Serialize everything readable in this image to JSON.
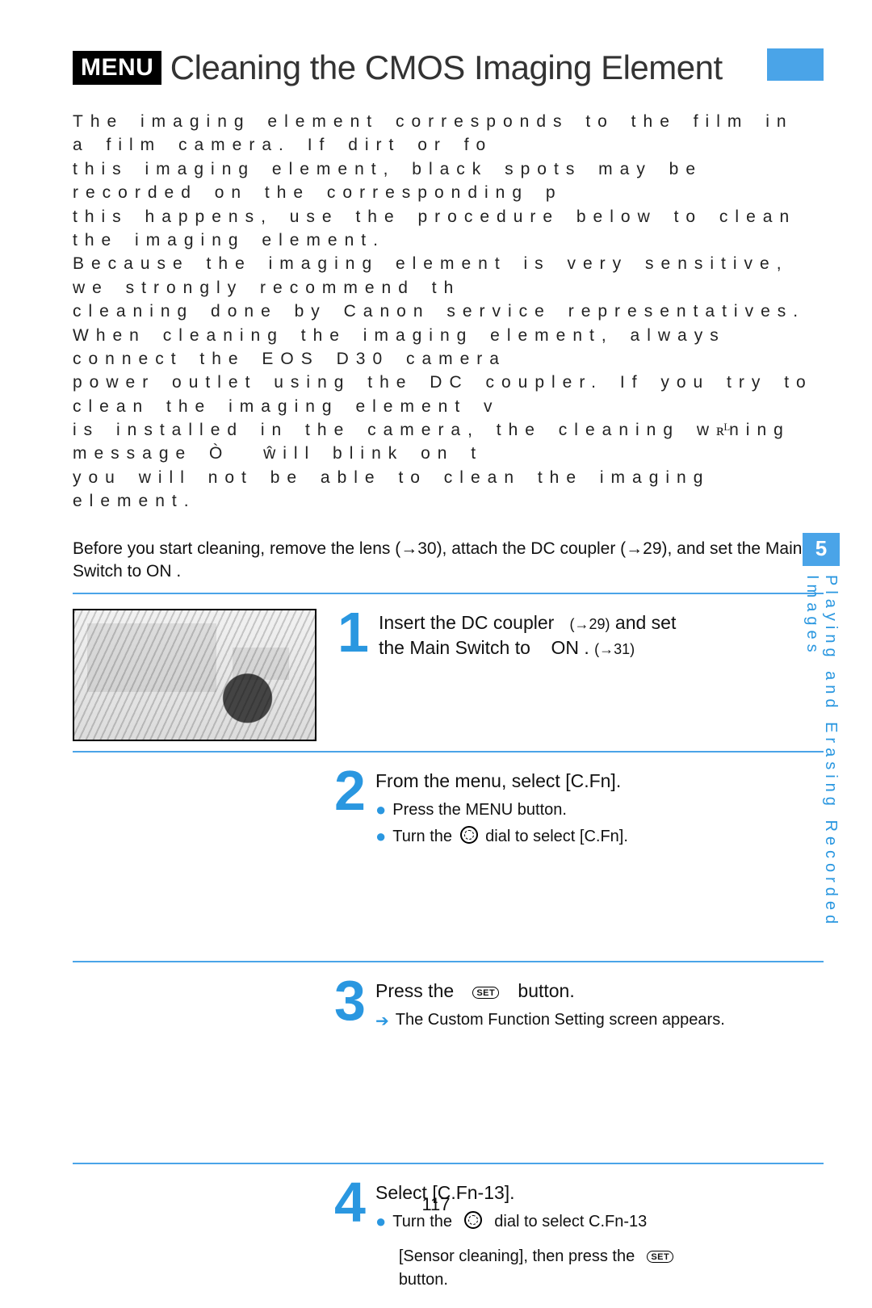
{
  "header": {
    "menu_badge": "MENU",
    "title": "Cleaning the CMOS Imaging Element"
  },
  "intro": {
    "p1": "The imaging element corresponds to the film in a film camera. If dirt or fo",
    "p2": "this imaging element, black spots may be recorded on the corresponding p",
    "p3": "this happens, use the procedure below to clean the imaging element.",
    "p4": "Because the imaging element is very sensitive, we strongly recommend th",
    "p5": "cleaning done by Canon service representatives.",
    "p6": "When cleaning the imaging element, always connect the EOS D30 camera",
    "p7_a": "power outlet using the DC coupler. If you try to clean the imaging element v",
    "p8_a": "is installed in the camera, the cleaning w",
    "p8_glyph": "ʀᴸ",
    "p8_b": "ning message Ò",
    "p8_c": "ŵill blink on t",
    "p9": "you will not be able to clean the imaging element."
  },
  "before": "Before you start cleaning, remove the lens (→30), attach the DC coupler (→29), and set the Main Switch to ON .",
  "steps": {
    "s1": {
      "num": "1",
      "line1_a": "Insert the DC coupler",
      "line1_ref": "(→29)",
      "line1_b": "and set",
      "line2_a": "the Main Switch to",
      "line2_b": "ON .",
      "line2_ref": "(→31)"
    },
    "s2": {
      "num": "2",
      "head": "From the menu, select [C.Fn].",
      "b1": "Press the  MENU  button.",
      "b2_a": "Turn the",
      "b2_b": "dial to select [C.Fn]."
    },
    "s3": {
      "num": "3",
      "head_a": "Press the",
      "set_label": "SET",
      "head_b": "button.",
      "arrow_text": "The Custom Function Setting screen appears."
    },
    "s4": {
      "num": "4",
      "head": "Select [C.Fn-13].",
      "b1_a": "Turn the",
      "b1_b": "dial to select C.Fn-13",
      "b2_a": "[Sensor cleaning], then press the",
      "set_label": "SET",
      "b2_b": "button."
    }
  },
  "side": {
    "chapter_num": "5",
    "label": "Playing and Erasing Recorded Images"
  },
  "page_number": "117"
}
